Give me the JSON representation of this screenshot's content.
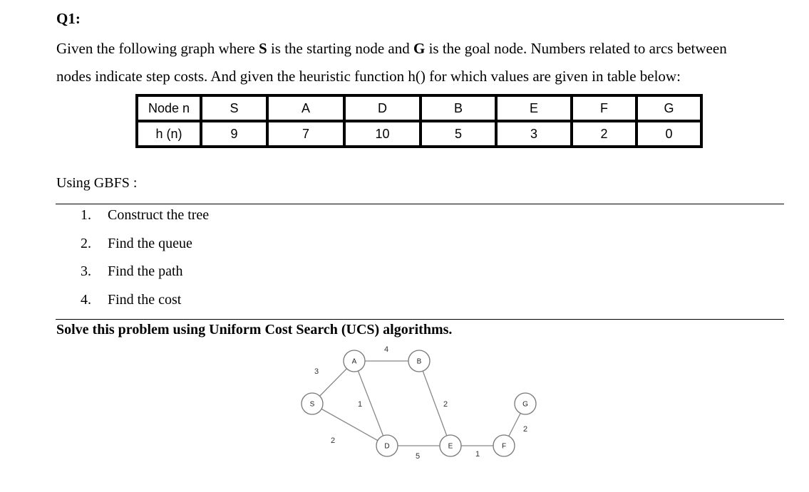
{
  "question": {
    "title": "Q1:",
    "line1": [
      "Given the following graph where ",
      "S",
      " is the starting node and ",
      "G",
      " is the goal node. Numbers related to arcs between"
    ],
    "line2": "nodes indicate step costs. And given the heuristic function h() for which values are given in table below:"
  },
  "heuristic_table": {
    "header": [
      "Node n",
      "S",
      "A",
      "D",
      "B",
      "E",
      "F",
      "G"
    ],
    "row": [
      "h (n)",
      "9",
      "7",
      "10",
      "5",
      "3",
      "2",
      "0"
    ]
  },
  "method": "Using GBFS :",
  "tasks": [
    {
      "num": "1.",
      "text": "Construct the tree"
    },
    {
      "num": "2.",
      "text": "Find the queue"
    },
    {
      "num": "3.",
      "text": "Find the path"
    },
    {
      "num": "4.",
      "text": "Find the cost"
    }
  ],
  "ucs_instruction": "Solve this problem using Uniform Cost Search (UCS) algorithms.",
  "graph": {
    "nodes": [
      "S",
      "A",
      "B",
      "D",
      "E",
      "F",
      "G"
    ],
    "edges": [
      {
        "from": "S",
        "to": "A",
        "cost": "3"
      },
      {
        "from": "A",
        "to": "B",
        "cost": "4"
      },
      {
        "from": "A",
        "to": "D",
        "cost": "1"
      },
      {
        "from": "B",
        "to": "E",
        "cost": "2"
      },
      {
        "from": "S",
        "to": "D",
        "cost": "2"
      },
      {
        "from": "D",
        "to": "E",
        "cost": "5"
      },
      {
        "from": "E",
        "to": "F",
        "cost": "1"
      },
      {
        "from": "F",
        "to": "G",
        "cost": "2"
      }
    ]
  }
}
